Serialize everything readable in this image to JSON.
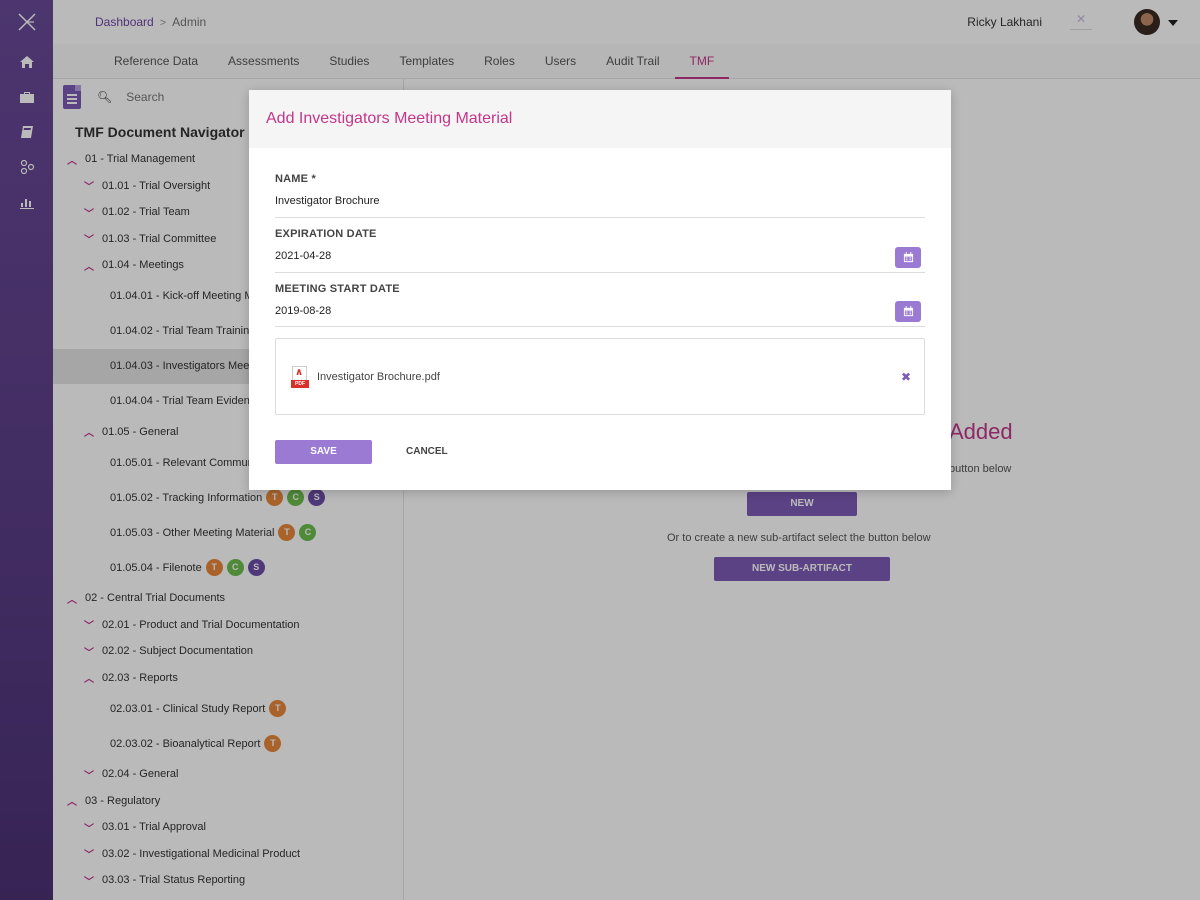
{
  "brand": {
    "logo_icon": "x-logo-icon",
    "accent": "#7d5bb6",
    "highlight": "#c2378a"
  },
  "rail": {
    "icons": [
      "home-icon",
      "briefcase-icon",
      "book-icon",
      "network-icon",
      "bar-chart-icon"
    ]
  },
  "breadcrumb": {
    "home": "Dashboard",
    "separator": ">",
    "current": "Admin"
  },
  "user": {
    "name": "Ricky Lakhani"
  },
  "tabs": [
    {
      "label": "Reference Data"
    },
    {
      "label": "Assessments"
    },
    {
      "label": "Studies"
    },
    {
      "label": "Templates"
    },
    {
      "label": "Roles"
    },
    {
      "label": "Users"
    },
    {
      "label": "Audit Trail"
    },
    {
      "label": "TMF",
      "active": true
    }
  ],
  "navigator": {
    "search_placeholder": "Search",
    "title": "TMF Document Navigator",
    "items": [
      {
        "label": "01 - Trial Management"
      },
      {
        "label": "01.01 - Trial Oversight"
      },
      {
        "label": "01.02 - Trial Team"
      },
      {
        "label": "01.03 - Trial Committee"
      },
      {
        "label": "01.04 - Meetings"
      },
      {
        "label": "01.04.01 - Kick-off Meeting M"
      },
      {
        "label": "01.04.02 - Trial Team Trainin"
      },
      {
        "label": "01.04.03 - Investigators Mee"
      },
      {
        "label": "01.04.04 - Trial Team Evidenc"
      },
      {
        "label": "01.05 - General"
      },
      {
        "label": "01.05.01 - Relevant Commun"
      },
      {
        "label": "01.05.02 - Tracking Information"
      },
      {
        "label": "01.05.03 - Other Meeting Material"
      },
      {
        "label": "01.05.04 - Filenote"
      },
      {
        "label": "02 - Central Trial Documents"
      },
      {
        "label": "02.01 - Product and Trial Documentation"
      },
      {
        "label": "02.02 - Subject Documentation"
      },
      {
        "label": "02.03 - Reports"
      },
      {
        "label": "02.03.01 - Clinical Study Report"
      },
      {
        "label": "02.03.02 - Bioanalytical Report"
      },
      {
        "label": "02.04 - General"
      },
      {
        "label": "03 - Regulatory"
      },
      {
        "label": "03.01 - Trial Approval"
      },
      {
        "label": "03.02 - Investigational Medicinal Product"
      },
      {
        "label": "03.03 - Trial Status Reporting"
      }
    ],
    "badges": {
      "t": "T",
      "c": "C",
      "s": "S"
    }
  },
  "main": {
    "empty_title": "Added",
    "hint_new": "button below",
    "new_button": "NEW",
    "hint_sub": "Or to create a new sub-artifact select the button below",
    "new_sub_button": "NEW SUB-ARTIFACT"
  },
  "modal": {
    "title": "Add Investigators Meeting Material",
    "name_label": "NAME *",
    "name_value": "Investigator Brochure",
    "expiration_label": "EXPIRATION DATE",
    "expiration_value": "2021-04-28",
    "meeting_label": "MEETING START DATE",
    "meeting_value": "2019-08-28",
    "attachment_name": "Investigator Brochure.pdf",
    "pdf_tag": "PDF",
    "remove_glyph": "✖",
    "save_label": "SAVE",
    "cancel_label": "CANCEL"
  }
}
